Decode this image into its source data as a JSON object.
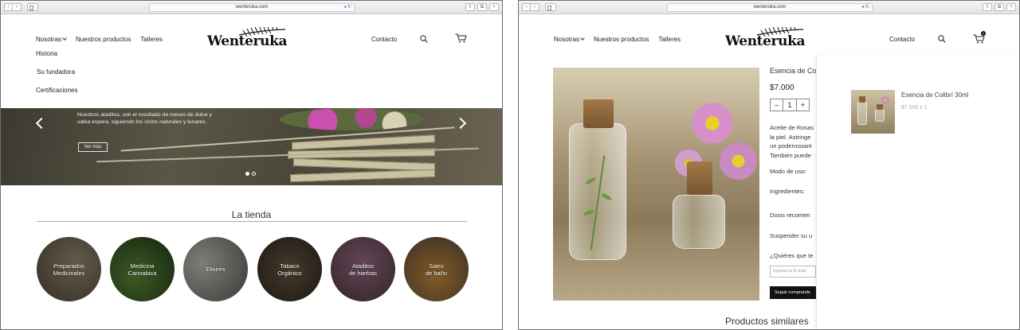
{
  "left": {
    "url": "wenteruka.com",
    "nav": {
      "nosotras": "Nosotras",
      "productos": "Nuestros productos",
      "talleres": "Talleres",
      "contacto": "Contacto"
    },
    "logo": "Wenteruka",
    "dropdown": [
      "Historia",
      "Su fundadora",
      "Certificaciones"
    ],
    "hero": {
      "text": "Nuestros ataditos, son el resultado de meses de dulce y sabia espera, siguiendo los ciclos naturales y lunares.",
      "button": "Ver más"
    },
    "shop_title": "La tienda",
    "categories": [
      "Preparados\nMedicinales",
      "Medicina\nCannabica",
      "Elixires",
      "Tabaco\nOrgánico",
      "Ataditos\nde hierbas",
      "Sales\nde baño"
    ]
  },
  "right": {
    "url": "wenteruka.com",
    "nav": {
      "nosotras": "Nosotras",
      "productos": "Nuestros productos",
      "talleres": "Talleres",
      "contacto": "Contacto"
    },
    "logo": "Wenteruka",
    "cart_count": "1",
    "product": {
      "name": "Esencia de Colibrí",
      "price": "$7.000",
      "qty_minus": "–",
      "qty": "1",
      "qty_plus": "+",
      "desc_lines": [
        "Aceite de Rosas",
        "la piel. Astringe",
        "un poderosoant",
        "También puede"
      ],
      "labels": [
        "Modo de uso:",
        "Ingredientes:",
        "Dosis recomen",
        "Suspender su u",
        "¿Quiéres que te"
      ],
      "email_placeholder": "Ingresa tu E-mail",
      "follow": "Seguir comprando"
    },
    "similar": "Productos similares",
    "cart_item": {
      "name": "Esencia de Colibrí    30ml",
      "meta": "$7.000 x 1"
    }
  }
}
